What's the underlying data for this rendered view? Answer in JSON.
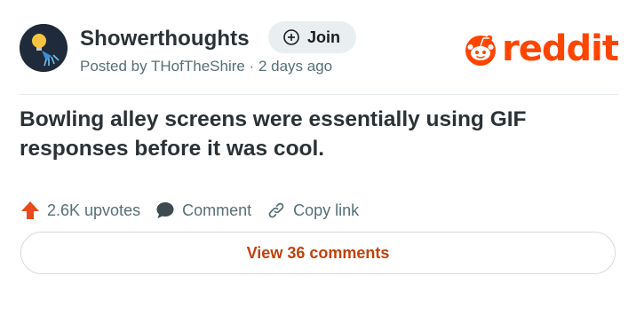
{
  "post": {
    "subreddit": "Showerthoughts",
    "posted_by": "Posted by THofTheShire · 2 days ago",
    "title": "Bowling alley screens were essentially using GIF responses before it was cool."
  },
  "header": {
    "join_label": "Join",
    "logo_text": "reddit"
  },
  "actions": {
    "upvotes_label": "2.6K upvotes",
    "comment_label": "Comment",
    "copy_link_label": "Copy link"
  },
  "footer": {
    "view_comments_label": "View 36 comments"
  },
  "colors": {
    "reddit_orange": "#ff4500",
    "upvote_orange": "#e8491d",
    "link_orange": "#c2410c",
    "muted_text": "#576f76",
    "join_bg": "#e9eef1"
  },
  "icons": {
    "avatar": "showerhead-lightbulb-icon",
    "join": "plus-circle-icon",
    "logo": "reddit-snoo-icon",
    "upvote": "upvote-arrow-icon",
    "comment": "speech-bubble-icon",
    "link": "chain-link-icon"
  }
}
